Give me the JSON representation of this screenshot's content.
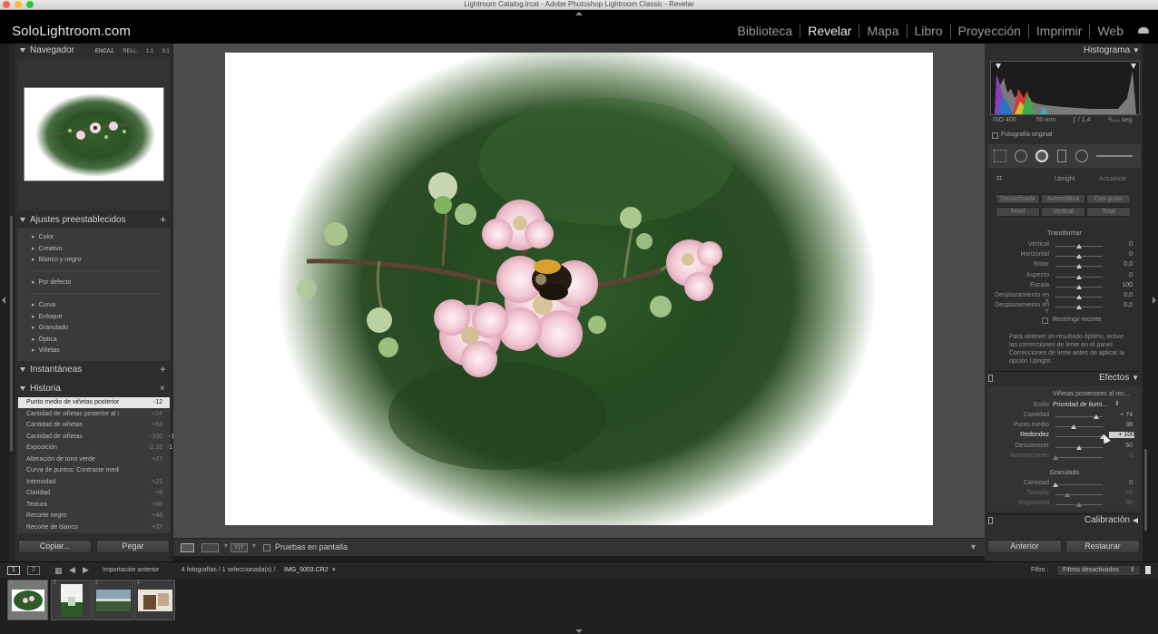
{
  "window": {
    "title": "Lightroom Catalog.lrcat - Adobe Photoshop Lightroom Classic - Revelar"
  },
  "identity": {
    "brand": "SoloLightroom.com"
  },
  "modules": [
    "Biblioteca",
    "Revelar",
    "Mapa",
    "Libro",
    "Proyección",
    "Imprimir",
    "Web"
  ],
  "active_module": "Revelar",
  "left": {
    "navigator": {
      "title": "Navegador",
      "modes": [
        "ENCAJ.",
        "RELL.",
        "1:1",
        "3:1"
      ]
    },
    "presets": {
      "title": "Ajustes preestablecidos",
      "groups_a": [
        "Color",
        "Creativo",
        "Blanco y negro"
      ],
      "groups_b": [
        "Por defecto"
      ],
      "groups_c": [
        "Curva",
        "Enfoque",
        "Granulado",
        "Óptica",
        "Viñetas"
      ]
    },
    "snapshots": {
      "title": "Instantáneas"
    },
    "history": {
      "title": "Historia",
      "rows": [
        {
          "name": "Punto medio de viñetas posterior a...",
          "a": "-12",
          "b": "38"
        },
        {
          "name": "Cantidad de viñetas posterior al rec...",
          "a": "+24",
          "b": "74"
        },
        {
          "name": "Cantidad de viñetas",
          "a": "+52",
          "b": "-48"
        },
        {
          "name": "Cantidad de viñetas",
          "a": "-100",
          "b": "-100"
        },
        {
          "name": "Exposición",
          "a": "-1,15",
          "b": "-1,00"
        },
        {
          "name": "Alteración de tono verde",
          "a": "+27",
          "b": "27"
        },
        {
          "name": "Curva de puntos: Contraste medio",
          "a": "",
          "b": ""
        },
        {
          "name": "Intensidad",
          "a": "+21",
          "b": "21"
        },
        {
          "name": "Claridad",
          "a": "+8",
          "b": "8"
        },
        {
          "name": "Textura",
          "a": "+30",
          "b": "30"
        },
        {
          "name": "Recorte negro",
          "a": "+48",
          "b": "48"
        },
        {
          "name": "Recorte de blanco",
          "a": "+37",
          "b": "37"
        }
      ]
    },
    "buttons": {
      "copy": "Copiar...",
      "paste": "Pegar"
    }
  },
  "toolbar": {
    "soft_proof": "Pruebas en pantalla"
  },
  "right": {
    "histogram": {
      "title": "Histograma",
      "iso": "ISO 400",
      "focal": "50 mm",
      "aperture": "ƒ / 1,4",
      "shutter": "¹/₆₄₀ seg",
      "original": "Fotografía original"
    },
    "upright": {
      "label": "Upright",
      "update": "Actualizar",
      "modes_row1": [
        "Desactivada",
        "Automática",
        "Con guías"
      ],
      "modes_row2": [
        "Nivel",
        "Vertical",
        "Total"
      ]
    },
    "transform": {
      "title": "Transformar",
      "sliders": [
        {
          "label": "Vertical",
          "value": "0",
          "pos": 0.5
        },
        {
          "label": "Horizontal",
          "value": "0",
          "pos": 0.5
        },
        {
          "label": "Rotar",
          "value": "0,0",
          "pos": 0.5
        },
        {
          "label": "Aspecto",
          "value": "0",
          "pos": 0.5
        },
        {
          "label": "Escala",
          "value": "100",
          "pos": 0.5
        },
        {
          "label": "Desplazamiento en X",
          "value": "0,0",
          "pos": 0.5
        },
        {
          "label": "Desplazamiento en Y",
          "value": "0,0",
          "pos": 0.5
        }
      ],
      "constrain": "Restringir recorte",
      "hint": "Para obtener un resultado óptimo, active las correcciones de lente en el panel Correcciones de lente antes de aplicar la opción Upright."
    },
    "effects": {
      "title": "Efectos",
      "vignette_title": "Viñetas posteriores al rec...",
      "style_label": "Estilo",
      "style_value": "Prioridad de ilumi...",
      "sliders": [
        {
          "label": "Cantidad",
          "value": "+ 74",
          "pos": 0.87
        },
        {
          "label": "Punto medio",
          "value": "38",
          "pos": 0.38
        },
        {
          "label": "Redondez",
          "value": "+ 100",
          "pos": 1.0,
          "active": true
        },
        {
          "label": "Desvanecer",
          "value": "50",
          "pos": 0.5
        },
        {
          "label": "Iluminaciones",
          "value": "0",
          "pos": 0.0,
          "dim": true
        }
      ]
    },
    "grain": {
      "title": "Granulado",
      "sliders": [
        {
          "label": "Cantidad",
          "value": "0",
          "pos": 0.0
        },
        {
          "label": "Tamaño",
          "value": "25",
          "pos": 0.25,
          "dim": true
        },
        {
          "label": "Rugosidad",
          "value": "50",
          "pos": 0.5,
          "dim": true
        }
      ]
    },
    "calibration": {
      "title": "Calibración"
    },
    "buttons": {
      "previous": "Anterior",
      "reset": "Restaurar"
    }
  },
  "filmstrip": {
    "screens": [
      "1",
      "2"
    ],
    "source": "Importación anterior",
    "info": "4 fotografías / 1 seleccionada(s) /",
    "filename": "IMG_5003.CR2",
    "filter_label": "Filtro :",
    "filter_value": "Filtros desactivados",
    "thumbs": [
      "1",
      "2",
      "3",
      "4"
    ]
  },
  "colors": {
    "accent_white": "#e6e6e6",
    "panel": "#2d2d2d",
    "background": "#4b4b4b"
  }
}
